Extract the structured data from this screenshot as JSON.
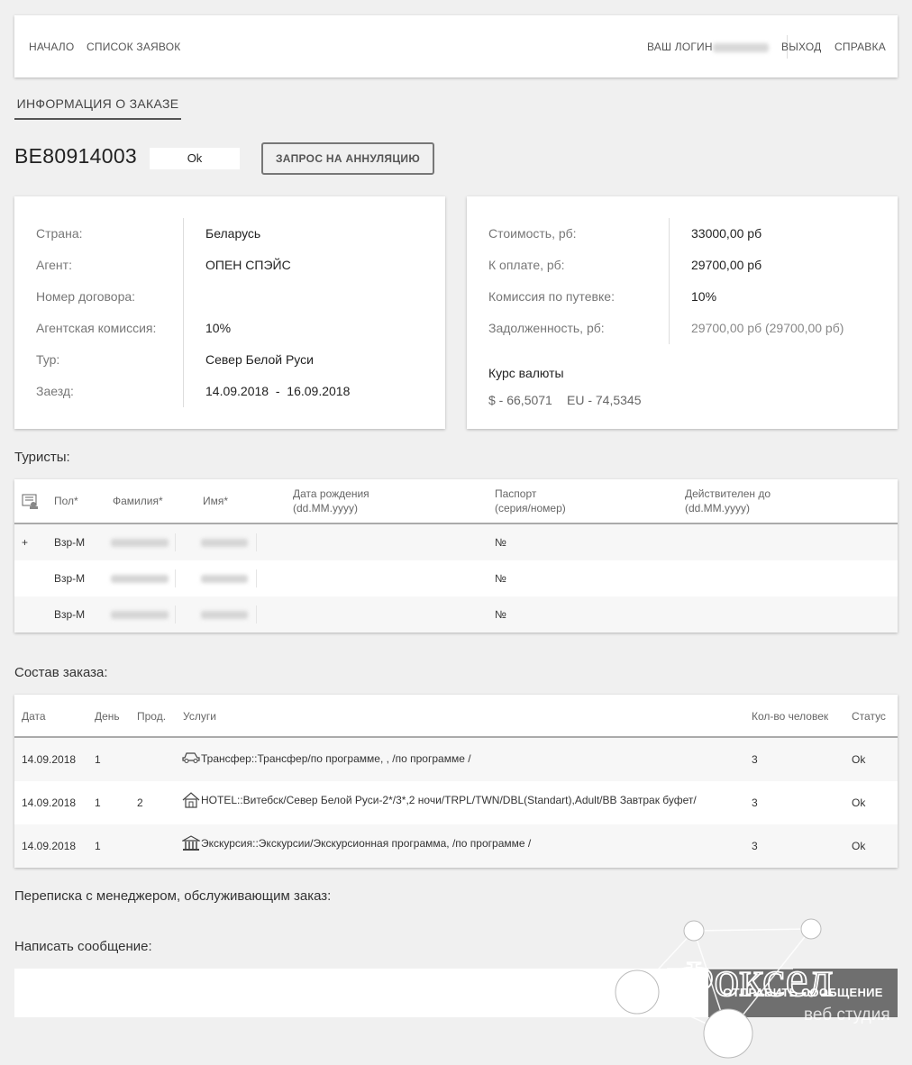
{
  "nav": {
    "home": "НАЧАЛО",
    "orders": "СПИСОК ЗАЯВОК",
    "login_label": "ВАШ ЛОГИН",
    "logout": "ВЫХОД",
    "help": "СПРАВКА"
  },
  "tab": {
    "label": "ИНФОРМАЦИЯ О ЗАКАЗЕ"
  },
  "order": {
    "number": "BE80914003",
    "status": "Ok",
    "cancel_label": "ЗАПРОС НА АННУЛЯЦИЮ"
  },
  "info": {
    "country_label": "Страна:",
    "country": "Беларусь",
    "agent_label": "Агент:",
    "agent": "ОПЕН СПЭЙС",
    "contract_label": "Номер договора:",
    "contract": "",
    "commission_label": "Агентская комиссия:",
    "commission": "10%",
    "tour_label": "Тур:",
    "tour": "Север Белой Руси",
    "checkin_label": "Заезд:",
    "checkin": "14.09.2018  -  16.09.2018"
  },
  "finance": {
    "cost_label": "Стоимость, рб:",
    "cost": "33000,00 рб",
    "topay_label": "К оплате, рб:",
    "topay": "29700,00 рб",
    "tour_commission_label": "Комиссия по путевке:",
    "tour_commission": "10%",
    "debt_label": "Задолженность, рб:",
    "debt": "29700,00 рб (29700,00 рб)",
    "rate_title": "Курс валюты",
    "usd": "$ - 66,5071",
    "eur": "EU - 74,5345"
  },
  "tourists": {
    "title": "Туристы:",
    "headers": {
      "sex": "Пол*",
      "surname": "Фамилия*",
      "name": "Имя*",
      "birth": "Дата рождения",
      "birth_fmt": "(dd.MM.yyyy)",
      "passport": "Паспорт",
      "passport_fmt": "(серия/номер)",
      "valid": "Действителен до",
      "valid_fmt": "(dd.MM.yyyy)"
    },
    "rows": [
      {
        "mark": "+",
        "sex": "Взр-М",
        "passport": "№"
      },
      {
        "mark": "",
        "sex": "Взр-М",
        "passport": "№"
      },
      {
        "mark": "",
        "sex": "Взр-М",
        "passport": "№"
      }
    ]
  },
  "composition": {
    "title": "Состав заказа:",
    "headers": {
      "date": "Дата",
      "day": "День",
      "dur": "Прод.",
      "service": "Услуги",
      "people": "Кол-во человек",
      "status": "Статус"
    },
    "rows": [
      {
        "date": "14.09.2018",
        "day": "1",
        "dur": "",
        "icon": "car-icon",
        "service": "Трансфер::Трансфер/по программе, , /по программе /",
        "people": "3",
        "status": "Ok"
      },
      {
        "date": "14.09.2018",
        "day": "1",
        "dur": "2",
        "icon": "house-icon",
        "service": "HOTEL::Витебск/Север Белой Руси-2*/3*,2 ночи/TRPL/TWN/DBL(Standart),Adult/BB Завтрак буфет/",
        "people": "3",
        "status": "Ok"
      },
      {
        "date": "14.09.2018",
        "day": "1",
        "dur": "",
        "icon": "museum-icon",
        "service": "Экскурсия::Экскурсии/Экскурсионная программа, /по программе /",
        "people": "3",
        "status": "Ok"
      }
    ]
  },
  "messages": {
    "correspondence_title": "Переписка с менеджером, обслуживающим заказ:",
    "write_title": "Написать сообщение:",
    "input_value": "",
    "send_label": "ОТПРАВИТЬ СООБЩЕНИЕ"
  },
  "watermark": {
    "brand": "Фоксел",
    "sub": "веб студия"
  }
}
